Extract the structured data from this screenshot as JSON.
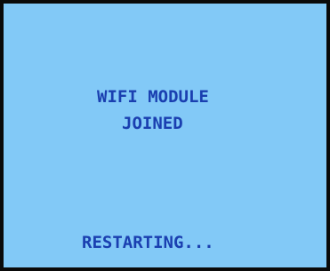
{
  "display": {
    "message_line1": "WIFI MODULE",
    "message_line2": "JOINED",
    "status": "RESTARTING..."
  },
  "colors": {
    "background": "#82c9f7",
    "text": "#1a3fb0",
    "border": "#0a0a0a"
  }
}
